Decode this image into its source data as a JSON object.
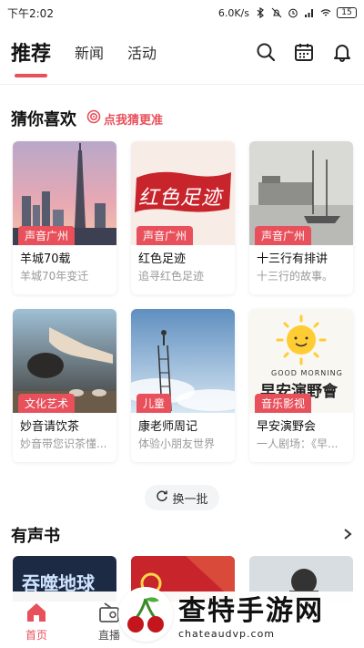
{
  "status_bar": {
    "time": "下午2:02",
    "network_speed": "6.0K/s",
    "battery": "15"
  },
  "header": {
    "tabs": [
      {
        "label": "推荐",
        "active": true
      },
      {
        "label": "新闻",
        "active": false
      },
      {
        "label": "活动",
        "active": false
      }
    ],
    "icons": [
      "search-icon",
      "calendar-icon",
      "bell-icon"
    ]
  },
  "guess_section": {
    "title": "猜你喜欢",
    "tag": "点我猜更准"
  },
  "cards": [
    {
      "badge": "声音广州",
      "title": "羊城70载",
      "subtitle": "羊城70年变迁"
    },
    {
      "badge": "声音广州",
      "title": "红色足迹",
      "subtitle": "追寻红色足迹"
    },
    {
      "badge": "声音广州",
      "title": "十三行有排讲",
      "subtitle": "十三行的故事。"
    },
    {
      "badge": "文化艺术",
      "title": "妙音请饮茶",
      "subtitle": "妙音带您识茶懂..."
    },
    {
      "badge": "儿童",
      "title": "康老师周记",
      "subtitle": "体验小朋友世界"
    },
    {
      "badge": "音乐影视",
      "title": "早安演野会",
      "subtitle": "一人剧场：《早..."
    }
  ],
  "thumb_text": {
    "red_footprint": "红色足迹",
    "good_morning": "GOOD MORNING",
    "morning_show": "早安演野會",
    "book1": "吞噬地球"
  },
  "refresh_label": "换一批",
  "audio_books": {
    "title": "有声书"
  },
  "bottom_nav": [
    {
      "label": "首页",
      "active": true
    },
    {
      "label": "直播",
      "active": false
    },
    {
      "label": "",
      "active": false
    },
    {
      "label": "",
      "active": false
    },
    {
      "label": "",
      "active": false
    }
  ],
  "watermark": {
    "title": "查特手游网",
    "url": "chateaudvp.com"
  },
  "colors": {
    "accent": "#e8505b"
  }
}
